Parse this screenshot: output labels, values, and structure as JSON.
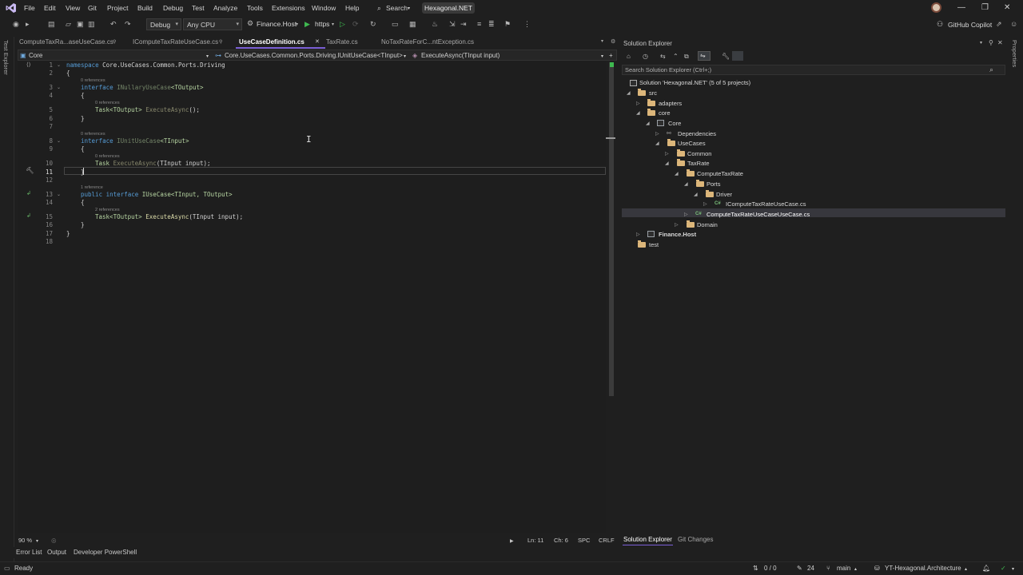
{
  "menu": [
    "File",
    "Edit",
    "View",
    "Git",
    "Project",
    "Build",
    "Debug",
    "Test",
    "Analyze",
    "Tools",
    "Extensions",
    "Window",
    "Help"
  ],
  "search_label": "Search",
  "solution_name": "Hexagonal.NET",
  "toolbar": {
    "config": "Debug",
    "platform": "Any CPU",
    "startup_project": "Finance.Host",
    "launch_profile": "https",
    "copilot": "GitHub Copilot"
  },
  "side_tabs": {
    "left": "Test Explorer",
    "right": "Properties"
  },
  "tabs": [
    "ComputeTaxRa...aseUseCase.cs",
    "IComputeTaxRateUseCase.cs",
    "UseCaseDefinition.cs",
    "TaxRate.cs",
    "NoTaxRateForC...ntException.cs"
  ],
  "nav": {
    "project": "Core",
    "type": "Core.UseCases.Common.Ports.Driving.IUnitUseCase<TInput>",
    "member": "ExecuteAsync(TInput input)"
  },
  "code": {
    "line_numbers": [
      "1",
      "2",
      "3",
      "4",
      "5",
      "6",
      "7",
      "8",
      "9",
      "10",
      "11",
      "12",
      "13",
      "14",
      "15",
      "16",
      "17",
      "18"
    ],
    "l1_kw": "namespace",
    "l1_ns": "Core.UseCases.Common.Ports.Driving",
    "ref_a": "0 references",
    "l3_kw": "interface",
    "l3_name": "INullaryUseCase",
    "l3_tp": "<TOutput>",
    "ref_b": "0 references",
    "l5_type": "Task<TOutput>",
    "l5_fn": "ExecuteAsync",
    "l5_rest": "();",
    "ref_c": "0 references",
    "l8_kw": "interface",
    "l8_name": "IUnitUseCase",
    "l8_tp": "<TInput>",
    "ref_d": "0 references",
    "l10_type": "Task",
    "l10_fn": "ExecuteAsync",
    "l10_rest": "(TInput input);",
    "ref_e": "1 reference",
    "l13_kw": "public interface",
    "l13_name": "IUseCase",
    "l13_tp": "<TInput, TOutput>",
    "ref_f": "2 references",
    "l15_type": "Task<TOutput>",
    "l15_fn": "ExecuteAsync",
    "l15_rest": "(TInput input);",
    "open_brace": "{",
    "close_brace": "}"
  },
  "editor_status": {
    "zoom": "90 %",
    "ln": "Ln: 11",
    "ch": "Ch: 6",
    "spc": "SPC",
    "crlf": "CRLF"
  },
  "solution_explorer": {
    "title": "Solution Explorer",
    "search_placeholder": "Search Solution Explorer (Ctrl+;)",
    "tree": {
      "solution": "Solution 'Hexagonal.NET' (5 of 5 projects)",
      "src": "src",
      "adapters": "adapters",
      "core_folder": "core",
      "core_proj": "Core",
      "dependencies": "Dependencies",
      "usecases": "UseCases",
      "common": "Common",
      "taxrate": "TaxRate",
      "computetaxrate": "ComputeTaxRate",
      "ports": "Ports",
      "driver": "Driver",
      "icompute": "IComputeTaxRateUseCase.cs",
      "computefile": "ComputeTaxRateUseCaseUseCase.cs",
      "domain": "Domain",
      "finance_host": "Finance.Host",
      "test": "test"
    },
    "bottom_tabs": [
      "Solution Explorer",
      "Git Changes"
    ]
  },
  "bottom_tabs": [
    "Error List",
    "Output",
    "Developer PowerShell"
  ],
  "status": {
    "ready": "Ready",
    "updown": "0 / 0",
    "changes": "24",
    "branch": "main",
    "repo": "YT-Hexagonal.Architecture"
  },
  "colors": {
    "accent": "#7b5fd6",
    "keyword": "#569cd6",
    "type": "#b8d7a3",
    "method": "#dcdcaa",
    "folder": "#dcb67a"
  }
}
